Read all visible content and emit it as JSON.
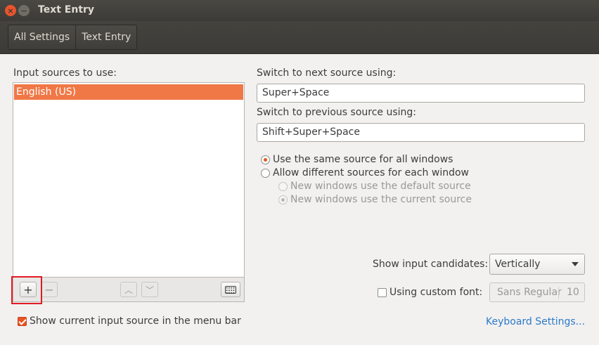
{
  "window": {
    "title": "Text Entry",
    "close_glyph": "×",
    "minimize_glyph": "−"
  },
  "breadcrumb": {
    "items": [
      {
        "label": "All Settings"
      },
      {
        "label": "Text Entry"
      }
    ]
  },
  "input_sources": {
    "label": "Input sources to use:",
    "items": [
      {
        "label": "English (US)",
        "selected": true
      }
    ],
    "toolbar": {
      "add": "+",
      "remove": "−",
      "up": "︿",
      "down": "﹀",
      "keyboard_icon": "keyboard-icon"
    }
  },
  "switching": {
    "next_label": "Switch to next source using:",
    "next_value": "Super+Space",
    "prev_label": "Switch to previous source using:",
    "prev_value": "Shift+Super+Space"
  },
  "source_mode": {
    "same": "Use the same source for all windows",
    "different": "Allow different sources for each window",
    "new_default": "New windows use the default source",
    "new_current": "New windows use the current source"
  },
  "candidates": {
    "label": "Show input candidates:",
    "value": "Vertically"
  },
  "custom_font": {
    "label": "Using custom font:",
    "font_name": "Sans Regular",
    "font_size": "10"
  },
  "menu_bar": {
    "label": "Show current input source in the menu bar"
  },
  "keyboard_settings_link": "Keyboard Settings...",
  "colors": {
    "accent": "#e95420",
    "selection": "#f07746",
    "titlebar": "#3c3b37",
    "link": "#2d7ac8",
    "highlight_annotation": "#e01b24"
  }
}
